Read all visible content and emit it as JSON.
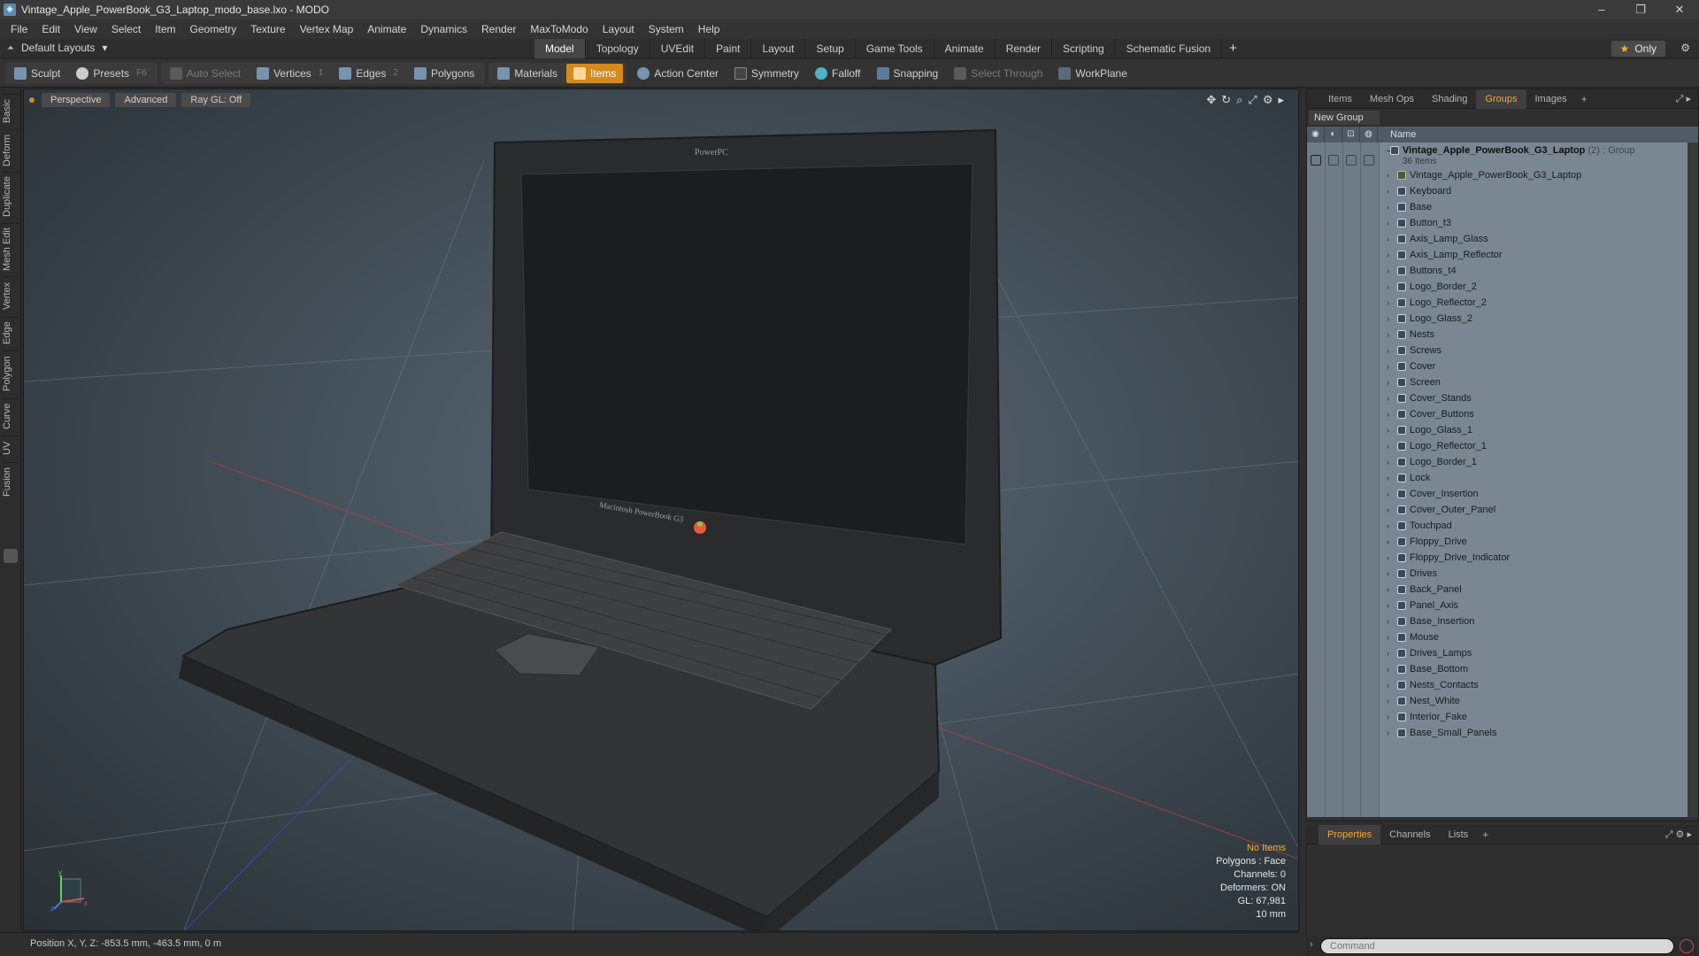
{
  "window": {
    "title": "Vintage_Apple_PowerBook_G3_Laptop_modo_base.lxo - MODO",
    "icon": "modo-app-icon",
    "controls": [
      "–",
      "❐",
      "✕"
    ]
  },
  "menu": [
    "File",
    "Edit",
    "View",
    "Select",
    "Item",
    "Geometry",
    "Texture",
    "Vertex Map",
    "Animate",
    "Dynamics",
    "Render",
    "MaxToModo",
    "Layout",
    "System",
    "Help"
  ],
  "layout_bar": {
    "layout_name": "Default Layouts",
    "tabs": [
      "Model",
      "Topology",
      "UVEdit",
      "Paint",
      "Layout",
      "Setup",
      "Game Tools",
      "Animate",
      "Render",
      "Scripting",
      "Schematic Fusion"
    ],
    "active_tab": "Model",
    "plus": "+",
    "only_label": "Only"
  },
  "toolbar": {
    "sculpt": "Sculpt",
    "presets": "Presets",
    "presets_key": "F6",
    "auto_select": "Auto Select",
    "vertices": "Vertices",
    "vertices_count": "1",
    "edges": "Edges",
    "edges_count": "2",
    "polygons": "Polygons",
    "materials": "Materials",
    "items": "Items",
    "action_center": "Action Center",
    "symmetry": "Symmetry",
    "falloff": "Falloff",
    "snapping": "Snapping",
    "select_through": "Select Through",
    "workplane": "WorkPlane"
  },
  "left_tabs": [
    "Basic",
    "Deform",
    "Duplicate",
    "Mesh Edit",
    "Vertex",
    "Edge",
    "Polygon",
    "Curve",
    "UV",
    "Fusion"
  ],
  "viewport": {
    "view_mode": "Perspective",
    "shading": "Advanced",
    "raygl": "Ray GL: Off",
    "screen_bezel_text": "PowerPC",
    "base_text": "Macintosh PowerBook G3",
    "info": {
      "selection": "No Items",
      "polygons": "Polygons : Face",
      "channels": "Channels: 0",
      "deformers": "Deformers: ON",
      "gl": "GL: 67,981",
      "scale": "10 mm"
    },
    "axis_labels": {
      "y": "y",
      "x": "x",
      "z": "z"
    },
    "colors": {
      "accent": "#d48a1e",
      "warn": "#f0b03c"
    }
  },
  "status": {
    "position": "Position X, Y, Z:  -853.5 mm, -463.5 mm, 0 m"
  },
  "right_panel": {
    "top_tabs": [
      "Items",
      "Mesh Ops",
      "Shading",
      "Groups",
      "Images"
    ],
    "active_top_tab": "Groups",
    "new_group": "New Group",
    "header_name": "Name",
    "group": {
      "name": "Vintage_Apple_PowerBook_G3_Laptop",
      "type": "(2) : Group",
      "count": "36 Items"
    },
    "items": [
      "Vintage_Apple_PowerBook_G3_Laptop",
      "Keyboard",
      "Base",
      "Button_t3",
      "Axis_Lamp_Glass",
      "Axis_Lamp_Reflector",
      "Buttons_t4",
      "Logo_Border_2",
      "Logo_Reflector_2",
      "Logo_Glass_2",
      "Nests",
      "Screws",
      "Cover",
      "Screen",
      "Cover_Stands",
      "Cover_Buttons",
      "Logo_Glass_1",
      "Logo_Reflector_1",
      "Logo_Border_1",
      "Lock",
      "Cover_Insertion",
      "Cover_Outer_Panel",
      "Touchpad",
      "Floppy_Drive",
      "Floppy_Drive_Indicator",
      "Drives",
      "Back_Panel",
      "Panel_Axis",
      "Base_Insertion",
      "Mouse",
      "Drives_Lamps",
      "Base_Bottom",
      "Nests_Contacts",
      "Nest_White",
      "Interior_Fake",
      "Base_Small_Panels"
    ],
    "bottom_tabs": [
      "Properties",
      "Channels",
      "Lists"
    ],
    "active_bottom_tab": "Properties",
    "command_placeholder": "Command"
  }
}
